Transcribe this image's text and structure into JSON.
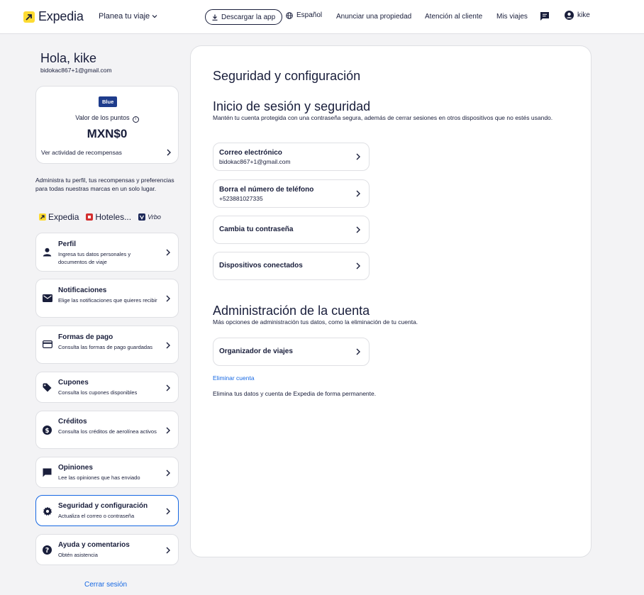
{
  "header": {
    "logo_text": "Expedia",
    "plan_label": "Planea tu viaje",
    "download_label": "Descargar la app",
    "language_label": "Español",
    "list_property_label": "Anunciar una propiedad",
    "support_label": "Atención al cliente",
    "trips_label": "Mis viajes",
    "user_label": "kike"
  },
  "profile": {
    "greeting": "Hola, kike",
    "email": "bidokac867+1@gmail.com"
  },
  "points": {
    "tier_badge": "Blue",
    "label": "Valor de los puntos",
    "value": "MXN$0",
    "activity_link": "Ver actividad de recompensas"
  },
  "admin_text": "Administra tu perfil, tus recompensas y preferencias para todas nuestras marcas en un solo lugar.",
  "brands": [
    "Expedia",
    "Hoteles...",
    "Vrbo"
  ],
  "menu": [
    {
      "title": "Perfil",
      "subtitle": "Ingresa tus datos personales y documentos de viaje",
      "icon": "person-icon"
    },
    {
      "title": "Notificaciones",
      "subtitle": "Elige las notificaciones que quieres recibir",
      "icon": "mail-icon"
    },
    {
      "title": "Formas de pago",
      "subtitle": "Consulta las formas de pago guardadas",
      "icon": "credit-card-icon"
    },
    {
      "title": "Cupones",
      "subtitle": "Consulta los cupones disponibles",
      "icon": "tag-icon"
    },
    {
      "title": "Créditos",
      "subtitle": "Consulta los créditos de aerolínea activos",
      "icon": "dollar-icon"
    },
    {
      "title": "Opiniones",
      "subtitle": "Lee las opiniones que has enviado",
      "icon": "comment-icon"
    },
    {
      "title": "Seguridad y configuración",
      "subtitle": "Actualiza el correo o contraseña",
      "icon": "gear-icon"
    },
    {
      "title": "Ayuda y comentarios",
      "subtitle": "Obtén asistencia",
      "icon": "help-icon"
    }
  ],
  "logout_label": "Cerrar sesión",
  "main": {
    "title": "Seguridad y configuración",
    "login_section": {
      "title": "Inicio de sesión y seguridad",
      "description": "Mantén tu cuenta protegida con una contraseña segura, además de cerrar sesiones en otros dispositivos que no estés usando.",
      "options": [
        {
          "title": "Correo electrónico",
          "subtitle": "bidokac867+1@gmail.com"
        },
        {
          "title": "Borra el número de teléfono",
          "subtitle": "+523881027335"
        },
        {
          "title": "Cambia tu contraseña",
          "subtitle": ""
        },
        {
          "title": "Dispositivos conectados",
          "subtitle": ""
        }
      ]
    },
    "account_section": {
      "title": "Administración de la cuenta",
      "description": "Más opciones de administración tus datos, como la eliminación de tu cuenta.",
      "options": [
        {
          "title": "Organizador de viajes",
          "subtitle": ""
        }
      ],
      "delete_link": "Eliminar cuenta",
      "delete_description": "Elimina tus datos y cuenta de Expedia de forma permanente."
    }
  },
  "colors": {
    "brand_yellow": "#fddb32",
    "link_blue": "#1668e3",
    "text_navy": "#191e3b",
    "badge_blue": "#1e3c8c"
  }
}
